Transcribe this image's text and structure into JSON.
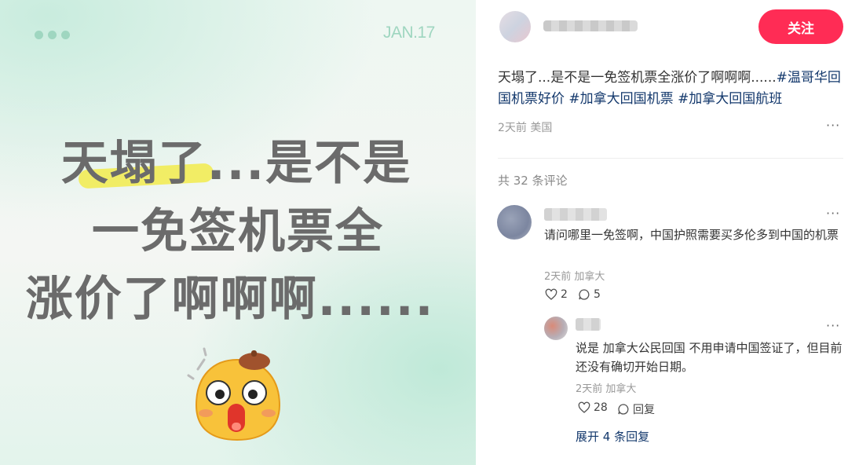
{
  "image_card": {
    "date": "JAN.17",
    "line1": "天塌了...是不是",
    "line2": "一免签机票全",
    "line3": "涨价了啊啊啊......"
  },
  "author": {
    "follow_label": "关注"
  },
  "post": {
    "text": "天塌了...是不是一免签机票全涨价了啊啊啊......",
    "tags": [
      "#温哥华回国机票好价",
      "#加拿大回国机票",
      "#加拿大回国航班"
    ],
    "meta": "2天前 美国"
  },
  "comments_count": "共 32 条评论",
  "comments": [
    {
      "text": "请问哪里一免签啊，中国护照需要买多伦多到中国的机票",
      "meta": "2天前 加拿大",
      "likes": "2",
      "replies": "5"
    }
  ],
  "reply": {
    "text": "说是 加拿大公民回国 不用申请中国签证了，但目前还没有确切开始日期。",
    "meta": "2天前 加拿大",
    "likes": "28",
    "reply_label": "回复"
  },
  "expand_label": "展开 4 条回复",
  "colors": {
    "accent": "#ff2c55",
    "tag": "#13386c",
    "mint": "#9fd6c0"
  }
}
